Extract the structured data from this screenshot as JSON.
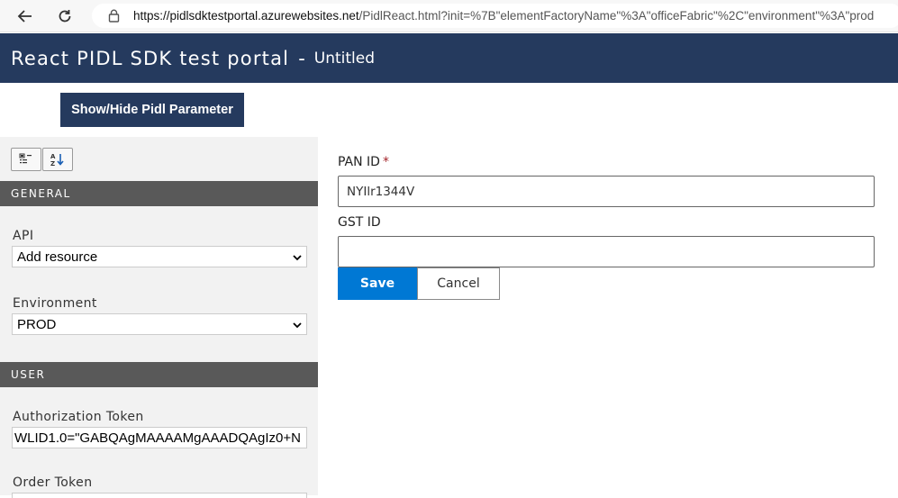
{
  "browser": {
    "url_host": "https://pidlsdktestportal.azurewebsites.net",
    "url_rest": "/PidlReact.html?init=%7B\"elementFactoryName\"%3A\"officeFabric\"%2C\"environment\"%3A\"prod"
  },
  "header": {
    "title": "React PIDL SDK test portal",
    "separator": "-",
    "subtitle": "Untitled"
  },
  "toolbar": {
    "toggle_label": "Show/Hide Pidl Parameter"
  },
  "left_panel": {
    "general_heading": "GENERAL",
    "api_label": "API",
    "api_value": "Add resource",
    "environment_label": "Environment",
    "environment_value": "PROD",
    "user_heading": "USER",
    "auth_label": "Authorization Token",
    "auth_value": "WLID1.0=\"GABQAgMAAAAMgAAADQAgIz0+N",
    "order_label": "Order Token"
  },
  "form": {
    "pan_label": "PAN ID",
    "pan_required_mark": "*",
    "pan_value": "NYIlr1344V",
    "gst_label": "GST ID",
    "gst_value": "",
    "save_label": "Save",
    "cancel_label": "Cancel"
  },
  "colors": {
    "header_bg": "#253a5e",
    "section_bg": "#595959",
    "primary": "#0078d4",
    "required": "#a4262c"
  }
}
